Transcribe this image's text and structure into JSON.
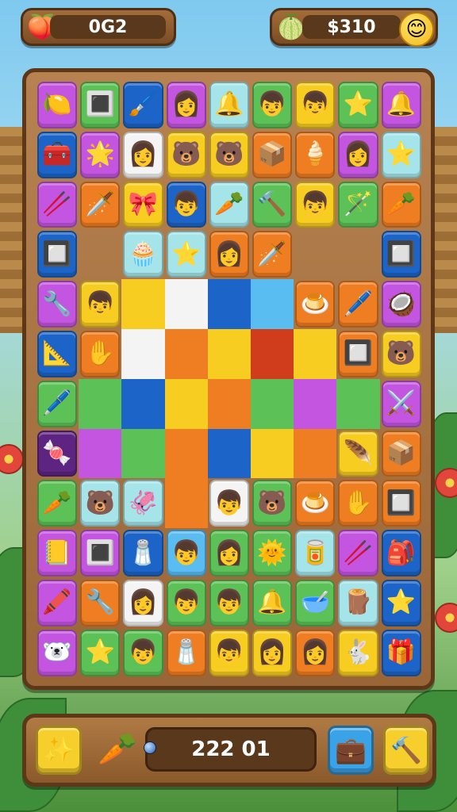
{
  "top_bar": {
    "left_counter": {
      "icon": "plum-icon",
      "glyph": "🍑",
      "value": "0G2"
    },
    "right_counter": {
      "icon": "melon-icon",
      "glyph": "🍈",
      "value": "$310",
      "avatar_glyph": "😊"
    }
  },
  "board": {
    "colors": {
      "P": "#c455e0",
      "G": "#5cc257",
      "B": "#1c64c7",
      "Y": "#f7cd21",
      "O": "#ef7d22",
      "L": "#a5e5ea",
      "R": "#cf3d1c",
      "W": "#f4f4f4",
      "S": "#59bdf2",
      "D": "#5e2482",
      "C": "#e8e8e8"
    },
    "rows": [
      [
        [
          "P",
          "🍋",
          "lemon"
        ],
        [
          "G",
          "🔳",
          "slab"
        ],
        [
          "B",
          "🖌️",
          "brush"
        ],
        [
          "P",
          "👩",
          "girl"
        ],
        [
          "L",
          "🔔",
          "bell"
        ],
        [
          "G",
          "👦",
          "boy"
        ],
        [
          "Y",
          "👦",
          "boy"
        ],
        [
          "G",
          "⭐",
          "star"
        ],
        [
          "P",
          "🔔",
          "bell"
        ]
      ],
      [
        [
          "B",
          "🧰",
          "chest"
        ],
        [
          "P",
          "🌟",
          "star-wand"
        ],
        [
          "W",
          "👩",
          "girl"
        ],
        [
          "Y",
          "🐻",
          "bear"
        ],
        [
          "Y",
          "🐻",
          "bear"
        ],
        [
          "O",
          "📦",
          "crate"
        ],
        [
          "O",
          "🍦",
          "swirl"
        ],
        [
          "P",
          "👩",
          "girl"
        ],
        [
          "L",
          "⭐",
          "star"
        ]
      ],
      [
        [
          "P",
          "🥢",
          "sticks"
        ],
        [
          "O",
          "🗡️",
          "sword"
        ],
        [
          "Y",
          "🎀",
          "ghost"
        ],
        [
          "B",
          "👦",
          "boy"
        ],
        [
          "L",
          "🥕",
          "leaf"
        ],
        [
          "G",
          "🔨",
          "hammer"
        ],
        [
          "Y",
          "👦",
          "boy"
        ],
        [
          "G",
          "🪄",
          "wand"
        ],
        [
          "O",
          "🥕",
          "carrot"
        ]
      ],
      [
        [
          "B",
          "🔲",
          "slab"
        ],
        [
          "_",
          "",
          ""
        ],
        [
          "L",
          "🧁",
          "cupcake"
        ],
        [
          "L",
          "⭐",
          "star"
        ],
        [
          "O",
          "👩",
          "girl"
        ],
        [
          "O",
          "🗡️",
          "sword"
        ],
        [
          "_",
          "",
          ""
        ],
        [
          "_",
          "",
          ""
        ],
        [
          "B",
          "🔲",
          "slab"
        ]
      ],
      [
        [
          "P",
          "🔧",
          "wrench"
        ],
        [
          "Y",
          "👦",
          "boy"
        ],
        [
          "Y~",
          "",
          ""
        ],
        [
          "W~",
          "",
          ""
        ],
        [
          "B~",
          "",
          ""
        ],
        [
          "S~",
          "",
          ""
        ],
        [
          "O",
          "🍮",
          "jelly"
        ],
        [
          "O",
          "🖊️",
          "pen"
        ],
        [
          "P",
          "🥥",
          "nut"
        ]
      ],
      [
        [
          "B",
          "📐",
          "ruler"
        ],
        [
          "O",
          "✋",
          "glove"
        ],
        [
          "W~",
          "",
          ""
        ],
        [
          "O~",
          "",
          ""
        ],
        [
          "Y~",
          "",
          ""
        ],
        [
          "R~",
          "",
          ""
        ],
        [
          "Y~",
          "",
          ""
        ],
        [
          "O",
          "🔲",
          "slab"
        ],
        [
          "Y",
          "🐻",
          "bear"
        ]
      ],
      [
        [
          "G",
          "🖊️",
          "pen"
        ],
        [
          "G~",
          "",
          ""
        ],
        [
          "B~",
          "",
          ""
        ],
        [
          "Y~",
          "",
          ""
        ],
        [
          "O~",
          "",
          ""
        ],
        [
          "G~",
          "",
          ""
        ],
        [
          "P~",
          "",
          ""
        ],
        [
          "G~",
          "",
          ""
        ],
        [
          "P",
          "⚔️",
          "swords"
        ]
      ],
      [
        [
          "D",
          "🍬",
          "candy"
        ],
        [
          "P~",
          "",
          ""
        ],
        [
          "G~",
          "",
          ""
        ],
        [
          "O~",
          "",
          ""
        ],
        [
          "B~",
          "",
          ""
        ],
        [
          "Y~",
          "",
          ""
        ],
        [
          "O~",
          "",
          ""
        ],
        [
          "Y",
          "🪶",
          "feather"
        ],
        [
          "O",
          "📦",
          "crate"
        ]
      ],
      [
        [
          "G",
          "🥕",
          "carrot"
        ],
        [
          "L",
          "🐻",
          "bear"
        ],
        [
          "L",
          "🦑",
          "squid"
        ],
        [
          "O~",
          "",
          ""
        ],
        [
          "W",
          "👦",
          "gnome"
        ],
        [
          "G",
          "🐻",
          "bear"
        ],
        [
          "O",
          "🍮",
          "jelly"
        ],
        [
          "O",
          "✋",
          "glove"
        ],
        [
          "O",
          "🔲",
          "slab"
        ]
      ],
      [
        [
          "P",
          "📒",
          "notebook"
        ],
        [
          "P",
          "🔳",
          "slab"
        ],
        [
          "B",
          "🧂",
          "jar"
        ],
        [
          "S",
          "👦",
          "boy"
        ],
        [
          "G",
          "👩",
          "girl"
        ],
        [
          "G",
          "🌞",
          "sun"
        ],
        [
          "L",
          "🥫",
          "bottle"
        ],
        [
          "P",
          "🥢",
          "sticks"
        ],
        [
          "B",
          "🎒",
          "bag"
        ]
      ],
      [
        [
          "P",
          "🖍️",
          "crayon"
        ],
        [
          "O",
          "🔧",
          "wrench"
        ],
        [
          "W",
          "👩",
          "girl"
        ],
        [
          "G",
          "👦",
          "boy"
        ],
        [
          "G",
          "👦",
          "boy"
        ],
        [
          "G",
          "🔔",
          "bell"
        ],
        [
          "G",
          "🥣",
          "bowl"
        ],
        [
          "L",
          "🪵",
          "barrel"
        ],
        [
          "B",
          "⭐",
          "star"
        ]
      ],
      [
        [
          "P",
          "🐻‍❄️",
          "polar-bear"
        ],
        [
          "G",
          "⭐",
          "star"
        ],
        [
          "G",
          "👦",
          "boy"
        ],
        [
          "O",
          "🧂",
          "jar"
        ],
        [
          "Y",
          "👦",
          "boy"
        ],
        [
          "Y",
          "👩",
          "girl"
        ],
        [
          "O",
          "👩",
          "girl"
        ],
        [
          "Y",
          "🐇",
          "rabbit"
        ],
        [
          "B",
          "🎁",
          "gift"
        ]
      ]
    ]
  },
  "bottom_bar": {
    "crystal_button": {
      "icon": "crystal-icon",
      "glyph": "✨"
    },
    "carrot_glyph": "🥕",
    "score": "222 01",
    "bag_button": {
      "icon": "bag-icon",
      "glyph": "💼"
    },
    "hammer_button": {
      "icon": "hammer-icon",
      "glyph": "🔨"
    }
  }
}
